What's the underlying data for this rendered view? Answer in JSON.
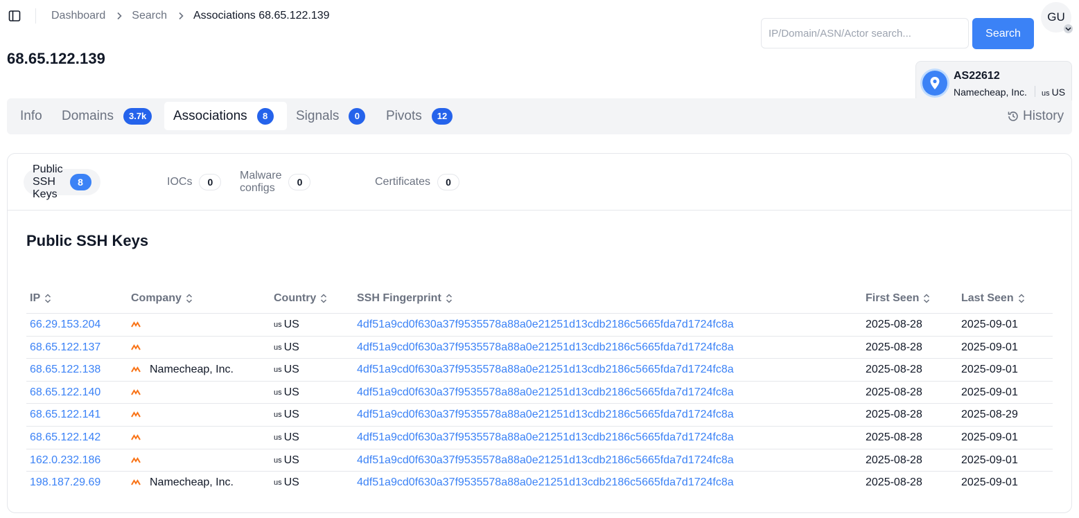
{
  "breadcrumb": {
    "items": [
      "Dashboard",
      "Search"
    ],
    "current": "Associations 68.65.122.139"
  },
  "page": {
    "title": "68.65.122.139"
  },
  "search": {
    "placeholder": "IP/Domain/ASN/Actor search...",
    "value": "",
    "button_label": "Search"
  },
  "user": {
    "initials": "GU"
  },
  "asn": {
    "number": "AS22612",
    "org": "Namecheap, Inc.",
    "country_code": "us",
    "country": "US"
  },
  "tabs": [
    {
      "label": "Info",
      "badge": null
    },
    {
      "label": "Domains",
      "badge": "3.7k"
    },
    {
      "label": "Associations",
      "badge": "8"
    },
    {
      "label": "Signals",
      "badge": "0"
    },
    {
      "label": "Pivots",
      "badge": "12"
    }
  ],
  "history_label": "History",
  "subtabs": [
    {
      "label": "Public SSH Keys",
      "count": "8"
    },
    {
      "label": "IOCs",
      "count": "0"
    },
    {
      "label": "Malware configs",
      "count": "0"
    },
    {
      "label": "Certificates",
      "count": "0"
    }
  ],
  "section_title": "Public SSH Keys",
  "table": {
    "columns": [
      "IP",
      "Company",
      "Country",
      "SSH Fingerprint",
      "First Seen",
      "Last Seen"
    ],
    "rows": [
      {
        "ip": "66.29.153.204",
        "company": "",
        "cc": "us",
        "country": "US",
        "fingerprint": "4df51a9cd0f630a37f9535578a88a0e21251d13cdb2186c5665fda7d1724fc8a",
        "first_seen": "2025-08-28",
        "last_seen": "2025-09-01"
      },
      {
        "ip": "68.65.122.137",
        "company": "",
        "cc": "us",
        "country": "US",
        "fingerprint": "4df51a9cd0f630a37f9535578a88a0e21251d13cdb2186c5665fda7d1724fc8a",
        "first_seen": "2025-08-28",
        "last_seen": "2025-09-01"
      },
      {
        "ip": "68.65.122.138",
        "company": "Namecheap, Inc.",
        "cc": "us",
        "country": "US",
        "fingerprint": "4df51a9cd0f630a37f9535578a88a0e21251d13cdb2186c5665fda7d1724fc8a",
        "first_seen": "2025-08-28",
        "last_seen": "2025-09-01"
      },
      {
        "ip": "68.65.122.140",
        "company": "",
        "cc": "us",
        "country": "US",
        "fingerprint": "4df51a9cd0f630a37f9535578a88a0e21251d13cdb2186c5665fda7d1724fc8a",
        "first_seen": "2025-08-28",
        "last_seen": "2025-09-01"
      },
      {
        "ip": "68.65.122.141",
        "company": "",
        "cc": "us",
        "country": "US",
        "fingerprint": "4df51a9cd0f630a37f9535578a88a0e21251d13cdb2186c5665fda7d1724fc8a",
        "first_seen": "2025-08-28",
        "last_seen": "2025-08-29"
      },
      {
        "ip": "68.65.122.142",
        "company": "",
        "cc": "us",
        "country": "US",
        "fingerprint": "4df51a9cd0f630a37f9535578a88a0e21251d13cdb2186c5665fda7d1724fc8a",
        "first_seen": "2025-08-28",
        "last_seen": "2025-09-01"
      },
      {
        "ip": "162.0.232.186",
        "company": "",
        "cc": "us",
        "country": "US",
        "fingerprint": "4df51a9cd0f630a37f9535578a88a0e21251d13cdb2186c5665fda7d1724fc8a",
        "first_seen": "2025-08-28",
        "last_seen": "2025-09-01"
      },
      {
        "ip": "198.187.29.69",
        "company": "Namecheap, Inc.",
        "cc": "us",
        "country": "US",
        "fingerprint": "4df51a9cd0f630a37f9535578a88a0e21251d13cdb2186c5665fda7d1724fc8a",
        "first_seen": "2025-08-28",
        "last_seen": "2025-09-01"
      }
    ]
  },
  "colors": {
    "accent": "#3b82f6",
    "badge": "#2563eb",
    "muted": "#6b7280",
    "logo": "#f97316"
  },
  "icons": {
    "sidebar": "sidebar-toggle-icon",
    "chevron": "chevron-right-icon",
    "sort": "sort-icon",
    "history": "history-icon",
    "location": "location-pin-icon",
    "company": "namecheap-logo-icon"
  }
}
